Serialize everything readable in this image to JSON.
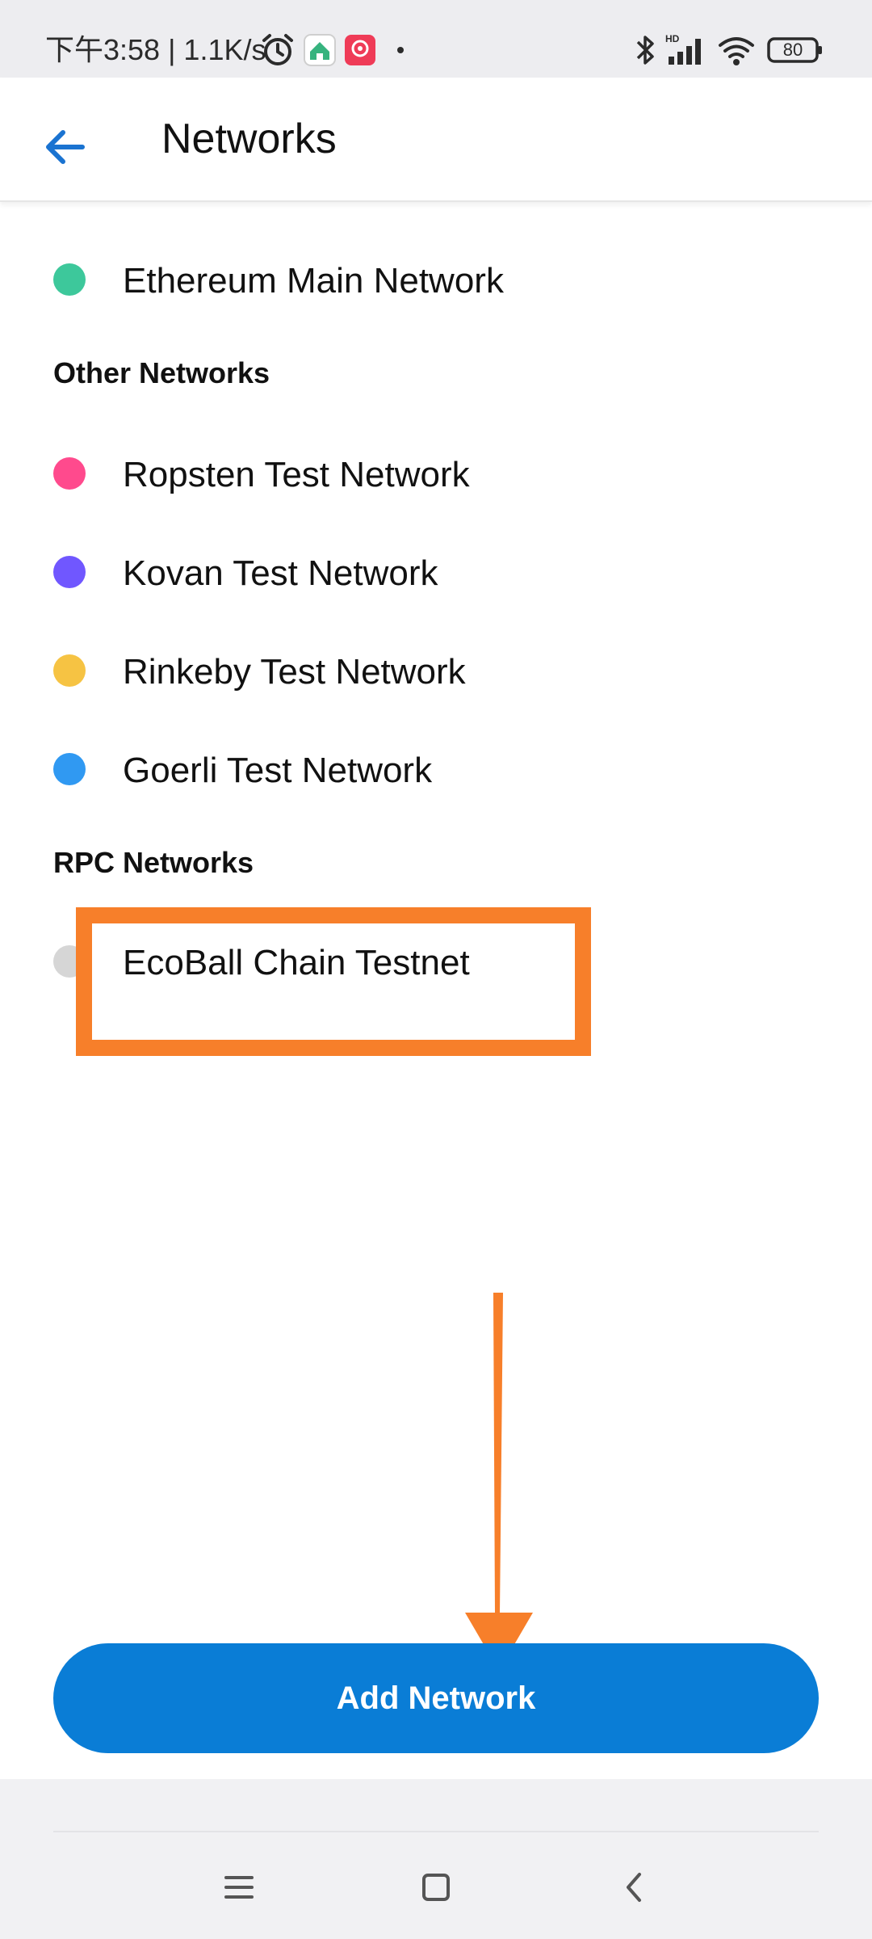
{
  "status_bar": {
    "time_and_speed": "下午3:58 | 1.1K/s",
    "icons": [
      "alarm-icon",
      "app-notification-icon",
      "app-notification-icon-2",
      "dot-icon",
      "bluetooth-icon",
      "signal-icon",
      "wifi-icon",
      "battery-icon"
    ],
    "battery": "80"
  },
  "header": {
    "title": "Networks",
    "back_icon": "back-arrow-icon"
  },
  "main_network": {
    "label": "Ethereum Main Network",
    "color": "#3dc89b"
  },
  "other_networks": {
    "heading": "Other Networks",
    "items": [
      {
        "label": "Ropsten Test Network",
        "color": "#ff4a8d"
      },
      {
        "label": "Kovan Test Network",
        "color": "#7057ff"
      },
      {
        "label": "Rinkeby Test Network",
        "color": "#f6c343"
      },
      {
        "label": "Goerli Test Network",
        "color": "#3099f2"
      }
    ]
  },
  "rpc_networks": {
    "heading": "RPC Networks",
    "items": [
      {
        "label": "EcoBall Chain Testnet",
        "color": "#d6d6d6"
      }
    ]
  },
  "annotation": {
    "highlight_color": "#f77f2a"
  },
  "add_button": {
    "label": "Add Network",
    "color": "#0a7dd6"
  },
  "nav_bar": {
    "icons": [
      "menu-icon",
      "home-square-icon",
      "back-chevron-icon"
    ]
  }
}
